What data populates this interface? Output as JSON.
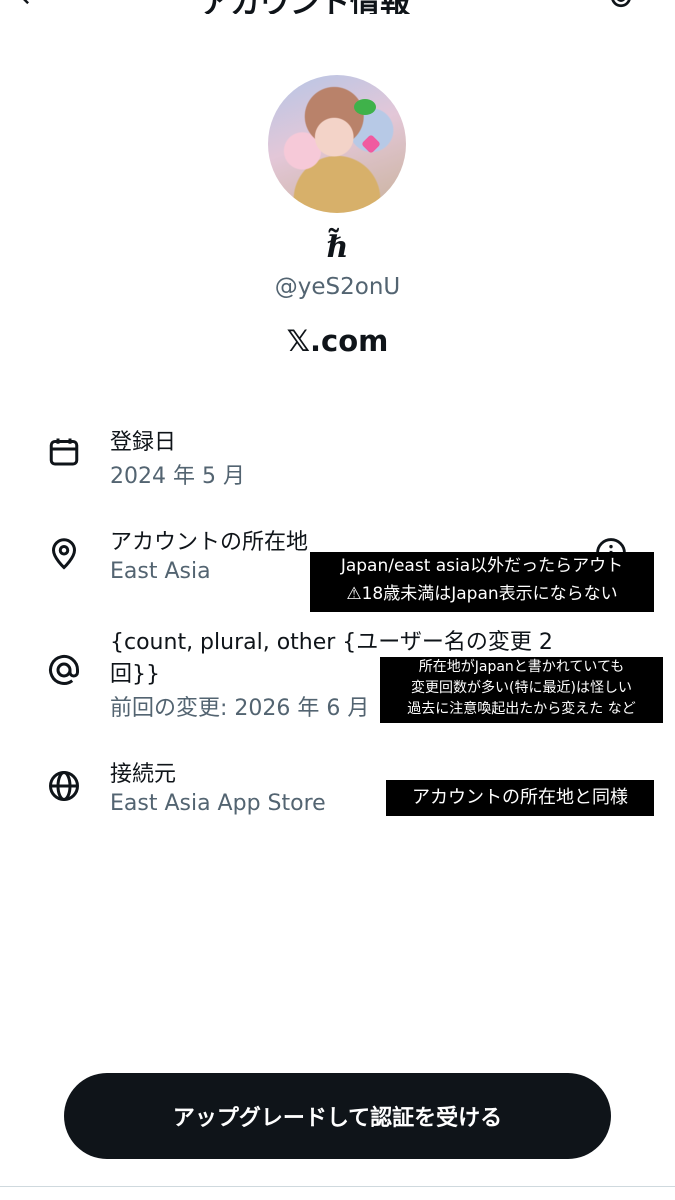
{
  "header": {
    "back_glyph": "←",
    "title": "アカウント情報"
  },
  "profile": {
    "display_name": "ℏ̃",
    "handle": "@yeS2onU",
    "domain": "𝕏.com"
  },
  "details": [
    {
      "label": "登録日",
      "value": "2024 年 5 月",
      "icon": "calendar-icon"
    },
    {
      "label": "アカウントの所在地",
      "value": "East Asia",
      "icon": "location-pin-icon"
    },
    {
      "label": "{count, plural, other {ユーザー名の変更 2",
      "label_cont": "回}}",
      "value": "前回の変更: 2026 年 6 月",
      "icon": "at-sign-icon"
    },
    {
      "label": "接続元",
      "value": "East Asia App Store",
      "icon": "globe-icon"
    }
  ],
  "annotations": {
    "note1_line1": "Japan/east asia以外だったらアウト",
    "note1_line2": "⚠18歳未満はJapan表示にならない",
    "note2_line1": "所在地がJapanと書かれていても",
    "note2_line2": "変更回数が多い(特に最近)は怪しい",
    "note2_line3": "過去に注意喚起出たから変えた など",
    "note3": "アカウントの所在地と同様"
  },
  "cta": {
    "label": "アップグレードして認証を受ける"
  },
  "colors": {
    "primary_text": "#0f1419",
    "secondary_text": "#536471",
    "cta_background": "#0f1419",
    "annotation_background": "#000000"
  }
}
